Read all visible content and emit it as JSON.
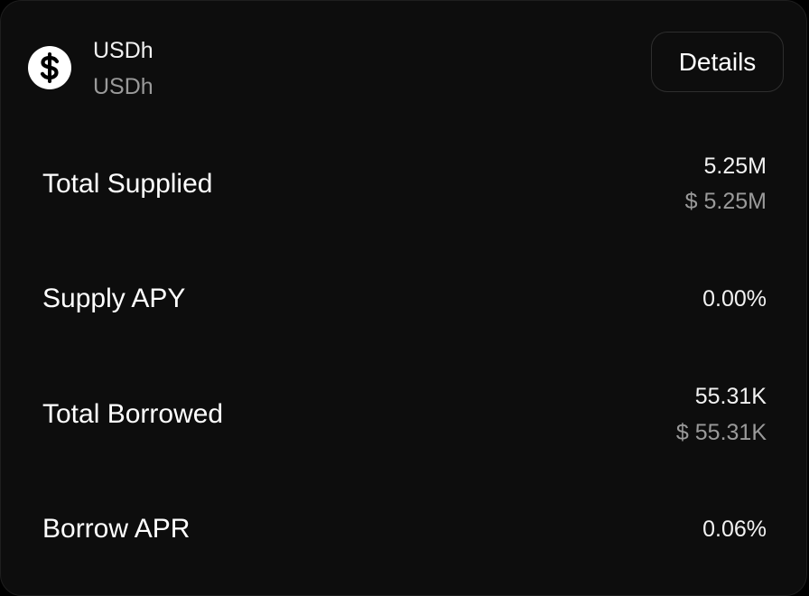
{
  "asset": {
    "name": "USDh",
    "symbol": "USDh",
    "icon": "dollar-icon"
  },
  "details_button": {
    "label": "Details"
  },
  "stats": {
    "total_supplied": {
      "label": "Total Supplied",
      "value": "5.25M",
      "usd_value": "$ 5.25M"
    },
    "supply_apy": {
      "label": "Supply APY",
      "value": "0.00%"
    },
    "total_borrowed": {
      "label": "Total Borrowed",
      "value": "55.31K",
      "usd_value": "$ 55.31K"
    },
    "borrow_apr": {
      "label": "Borrow APR",
      "value": "0.06%"
    }
  },
  "colors": {
    "background": "#0d0d0d",
    "primary_text": "#ffffff",
    "secondary_text": "#9a9a9a",
    "border": "#2e2e2e"
  }
}
